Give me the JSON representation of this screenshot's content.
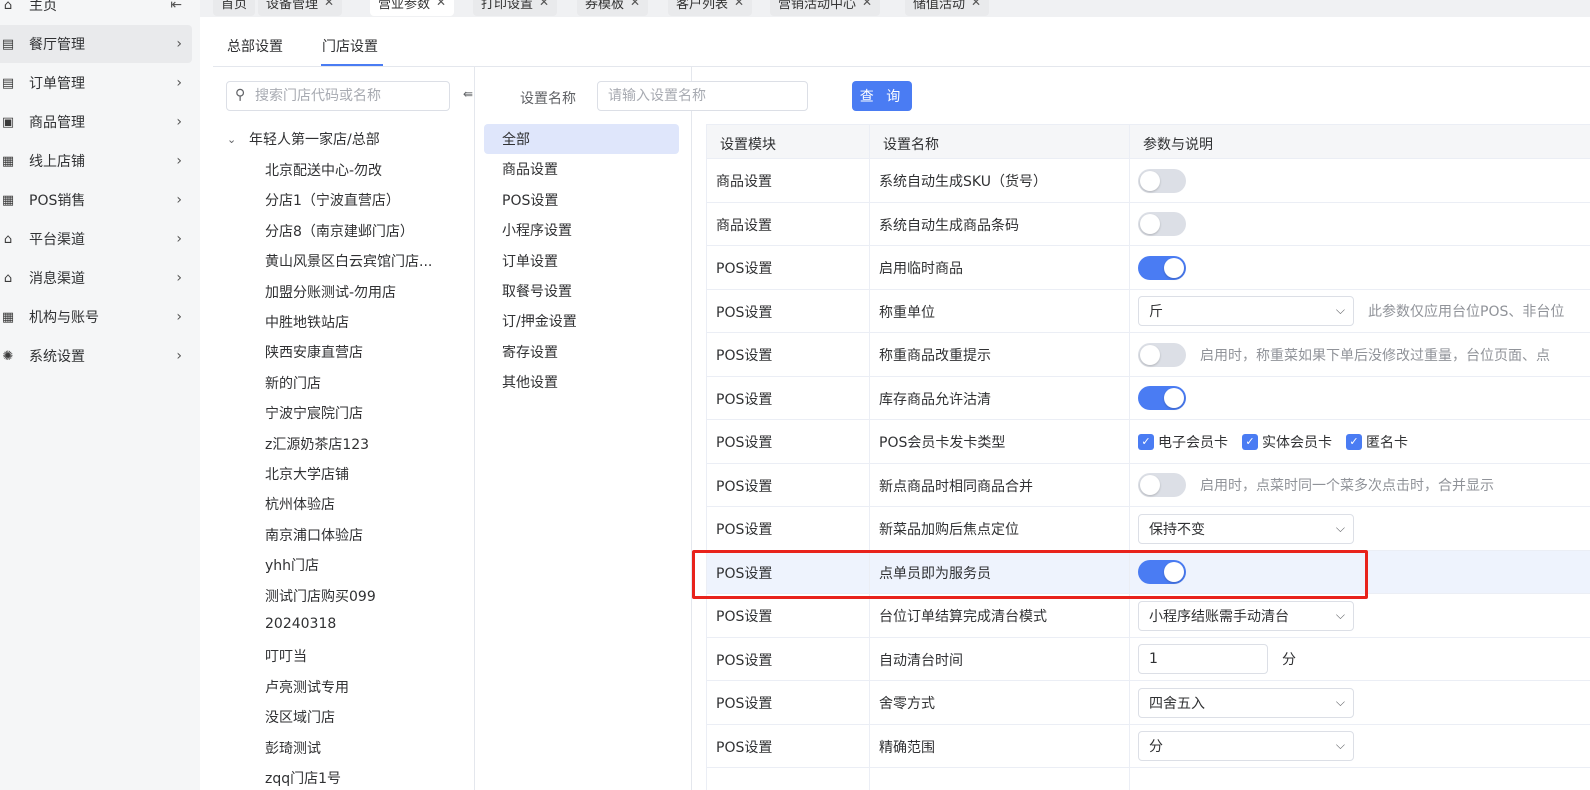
{
  "sidebar": {
    "items": [
      {
        "label": "主页",
        "icon": "home-icon",
        "arrow": "⇤"
      },
      {
        "label": "餐厅管理",
        "icon": "restaurant-icon",
        "arrow": "›"
      },
      {
        "label": "订单管理",
        "icon": "order-icon",
        "arrow": "›"
      },
      {
        "label": "商品管理",
        "icon": "product-icon",
        "arrow": "›"
      },
      {
        "label": "线上店铺",
        "icon": "shop-icon",
        "arrow": "›"
      },
      {
        "label": "POS销售",
        "icon": "pos-icon",
        "arrow": "›"
      },
      {
        "label": "平台渠道",
        "icon": "bank-icon",
        "arrow": "›"
      },
      {
        "label": "消息渠道",
        "icon": "bank-icon",
        "arrow": "›"
      },
      {
        "label": "机构与账号",
        "icon": "org-icon",
        "arrow": "›"
      },
      {
        "label": "系统设置",
        "icon": "gear-icon",
        "arrow": "›"
      }
    ]
  },
  "tabs": [
    {
      "label": "首页",
      "closable": false
    },
    {
      "label": "设备管理",
      "closable": true
    },
    {
      "label": "营业参数",
      "closable": true
    },
    {
      "label": "打印设置",
      "closable": true
    },
    {
      "label": "券模板",
      "closable": true
    },
    {
      "label": "客户列表",
      "closable": true
    },
    {
      "label": "营销活动中心",
      "closable": true
    },
    {
      "label": "储值活动",
      "closable": true
    }
  ],
  "subtabs": {
    "hq": "总部设置",
    "store": "门店设置"
  },
  "store_panel": {
    "search_placeholder": "搜索门店代码或名称",
    "collapse_glyph": "⇚",
    "root": "年轻人第一家店/总部",
    "stores": [
      "北京配送中心-勿改",
      "分店1（宁波直营店）",
      "分店8（南京建邺门店）",
      "黄山风景区白云宾馆门店...",
      "加盟分账测试-勿用店",
      "中胜地铁站店",
      "陕西安康直营店",
      "新的门店",
      "宁波宁宸院门店",
      "z汇源奶茶店123",
      "北京大学店铺",
      "杭州体验店",
      "南京浦口体验店",
      "yhh门店",
      "测试门店购买099",
      "20240318",
      "叮叮当",
      "卢亮测试专用",
      "没区域门店",
      "彭琦测试",
      "zqq门店1号"
    ]
  },
  "filter": {
    "label": "设置名称",
    "placeholder": "请输入设置名称",
    "query": "查 询"
  },
  "categories": [
    "全部",
    "商品设置",
    "POS设置",
    "小程序设置",
    "订单设置",
    "取餐号设置",
    "订/押金设置",
    "寄存设置",
    "其他设置"
  ],
  "table": {
    "headers": [
      "设置模块",
      "设置名称",
      "参数与说明"
    ],
    "rows": [
      {
        "module": "商品设置",
        "name": "系统自动生成SKU（货号）",
        "type": "switch",
        "on": false
      },
      {
        "module": "商品设置",
        "name": "系统自动生成商品条码",
        "type": "switch",
        "on": false
      },
      {
        "module": "POS设置",
        "name": "启用临时商品",
        "type": "switch",
        "on": true
      },
      {
        "module": "POS设置",
        "name": "称重单位",
        "type": "select",
        "value": "斤",
        "desc": "此参数仅应用台位POS、非台位"
      },
      {
        "module": "POS设置",
        "name": "称重商品改重提示",
        "type": "switch",
        "on": false,
        "desc": "启用时，称重菜如果下单后没修改过重量，台位页面、点"
      },
      {
        "module": "POS设置",
        "name": "库存商品允许沽清",
        "type": "switch",
        "on": true
      },
      {
        "module": "POS设置",
        "name": "POS会员卡发卡类型",
        "type": "checkboxes",
        "options": [
          "电子会员卡",
          "实体会员卡",
          "匿名卡"
        ]
      },
      {
        "module": "POS设置",
        "name": "新点商品时相同商品合并",
        "type": "switch",
        "on": false,
        "desc": "启用时，点菜时同一个菜多次点击时，合并显示"
      },
      {
        "module": "POS设置",
        "name": "新菜品加购后焦点定位",
        "type": "select",
        "value": "保持不变"
      },
      {
        "module": "POS设置",
        "name": "点单员即为服务员",
        "type": "switch",
        "on": true,
        "highlight": true
      },
      {
        "module": "POS设置",
        "name": "台位订单结算完成清台模式",
        "type": "select",
        "value": "小程序结账需手动清台"
      },
      {
        "module": "POS设置",
        "name": "自动清台时间",
        "type": "number",
        "value": "1",
        "unit": "分"
      },
      {
        "module": "POS设置",
        "name": "舍零方式",
        "type": "select",
        "value": "四舍五入"
      },
      {
        "module": "POS设置",
        "name": "精确范围",
        "type": "select",
        "value": "分"
      }
    ]
  }
}
